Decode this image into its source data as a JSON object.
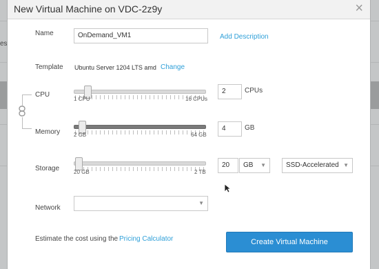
{
  "background": {
    "left_text": "es"
  },
  "modal": {
    "title": "New Virtual Machine on VDC-2z9y",
    "close_label": "×"
  },
  "name": {
    "label": "Name",
    "value": "OnDemand_VM1",
    "add_description": "Add Description"
  },
  "template": {
    "label": "Template",
    "value": "Ubuntu Server 1204 LTS amd",
    "change": "Change"
  },
  "cpu": {
    "label": "CPU",
    "min": "1 CPU",
    "max": "16 CPUs",
    "value": "2",
    "unit": "CPUs",
    "level": 0.07
  },
  "memory": {
    "label": "Memory",
    "min": "2 GB",
    "max": "64 GB",
    "value": "4",
    "unit": "GB",
    "level": 0.03
  },
  "storage": {
    "label": "Storage",
    "min": "20 GB",
    "max": "2 TB",
    "value": "20",
    "unit_selected": "GB",
    "type_selected": "SSD-Accelerated",
    "level": 0.0
  },
  "network": {
    "label": "Network",
    "selected": ""
  },
  "footer": {
    "estimate_text": "Estimate the cost using the",
    "pricing_link": "Pricing Calculator",
    "create_button": "Create Virtual Machine"
  },
  "colors": {
    "accent": "#2b8ed3",
    "link": "#2e9fd8"
  },
  "icons": [
    "close-icon",
    "chain-link-icon",
    "chevron-down-icon",
    "mouse-cursor-icon"
  ]
}
